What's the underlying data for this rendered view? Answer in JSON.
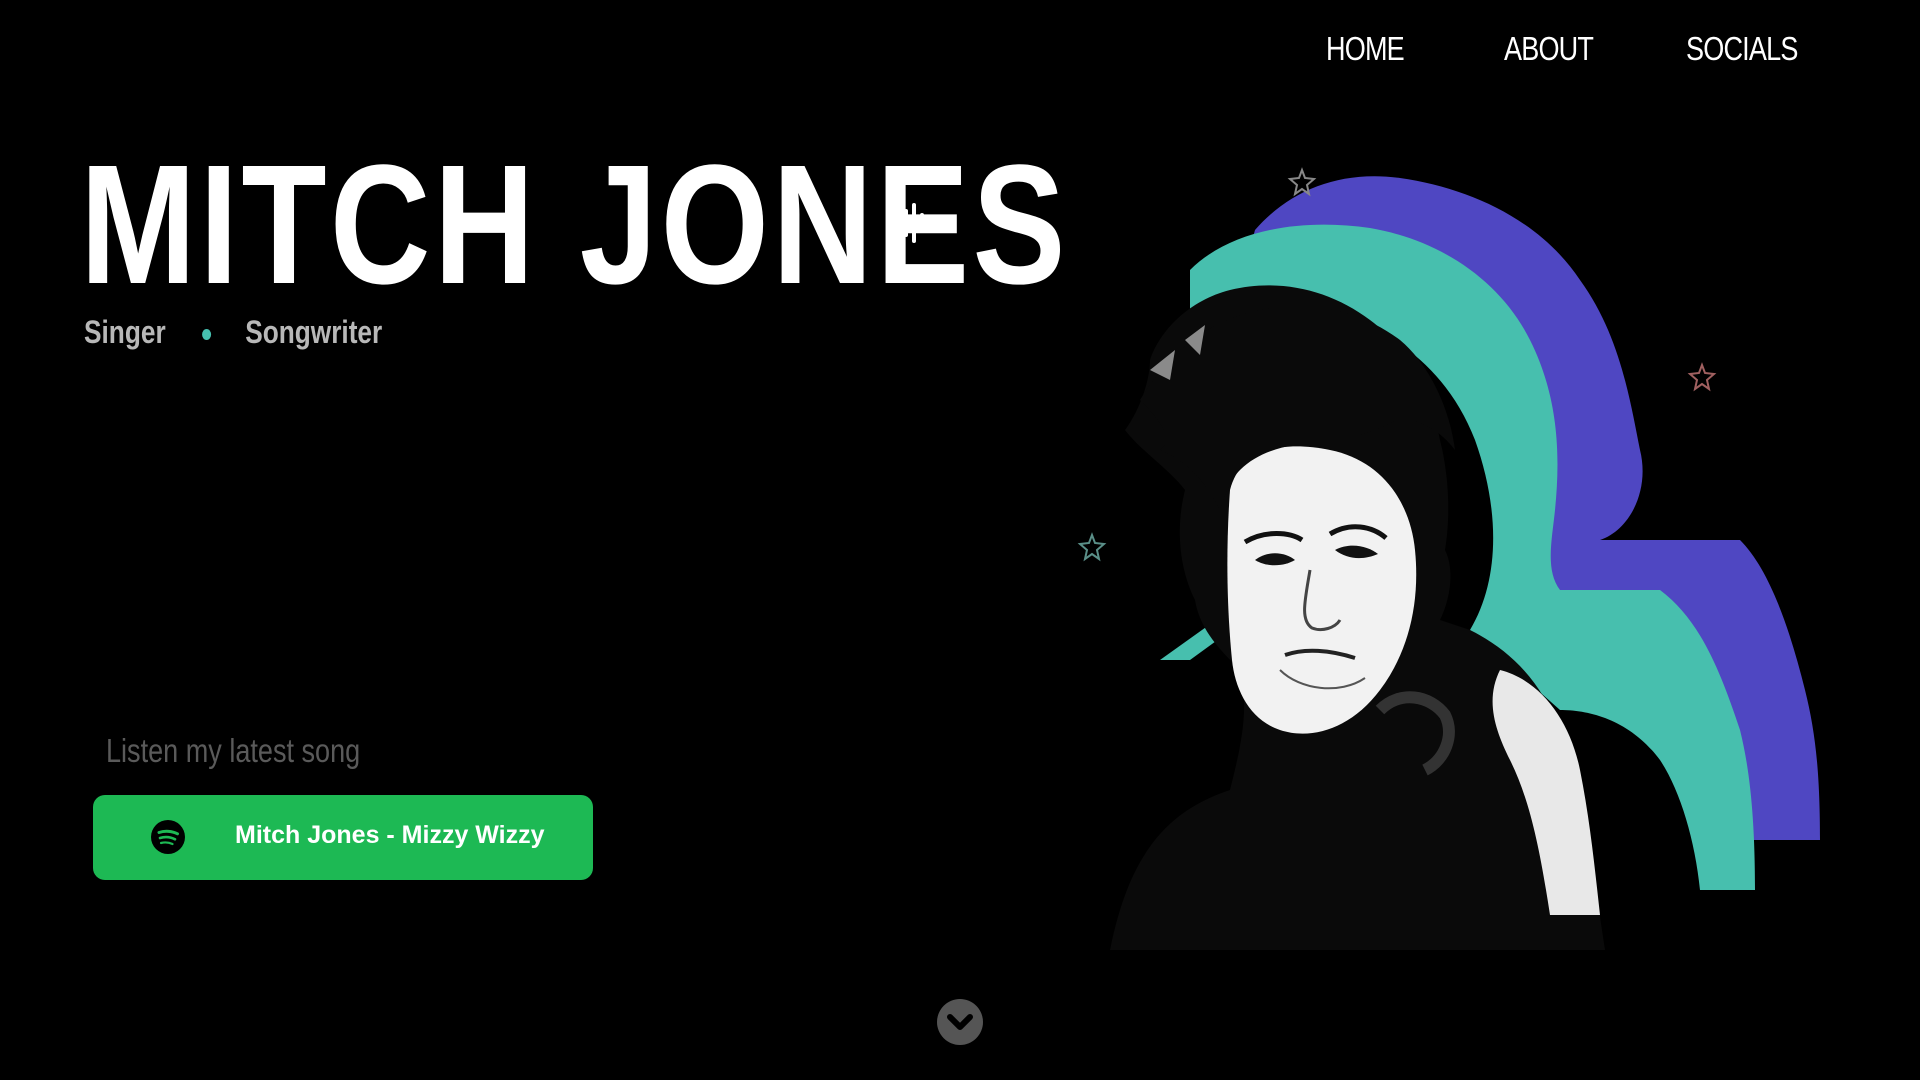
{
  "nav": {
    "items": [
      {
        "label": "HOME"
      },
      {
        "label": "ABOUT"
      },
      {
        "label": "SOCIALS"
      }
    ]
  },
  "hero": {
    "title": "MITCH JONES",
    "title_icon": "sound-wave-icon",
    "roles": [
      "Singer",
      "Songwriter"
    ],
    "separator_color": "#46c0b0"
  },
  "listen": {
    "label": "Listen my latest song",
    "button_label": "Mitch Jones - Mizzy Wizzy",
    "button_icon": "spotify-icon",
    "button_color": "#1db954"
  },
  "art": {
    "description_icons": [
      "star-icon",
      "star-icon",
      "star-icon"
    ],
    "stripe_colors": [
      "#4f47c2",
      "#47bfae"
    ]
  },
  "scroll": {
    "icon": "chevron-down-icon"
  }
}
